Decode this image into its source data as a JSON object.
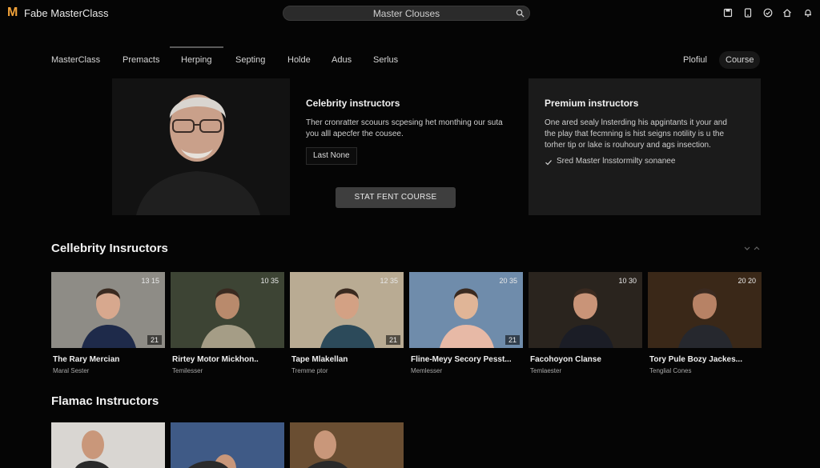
{
  "app": {
    "brand": "Fabe MasterClass"
  },
  "search": {
    "text": "Master Clouses"
  },
  "nav": {
    "items": [
      "MasterClass",
      "Premacts",
      "Herping",
      "Septing",
      "Holde",
      "Adus",
      "Serlus"
    ],
    "right": [
      "Plofiul",
      "Course"
    ]
  },
  "hero": {
    "center": {
      "title": "Celebrity instructors",
      "text1": "Ther cronratter scouurs scpesing het monthing our suta",
      "text2": "you alll apecfer the cousee.",
      "last_label": "Last None",
      "start_label": "STAT FENT COURSE"
    },
    "right": {
      "title": "Premium instructors",
      "text1": "One ared sealy lnsterding his apgintants it your and",
      "text2": "the play that fecmning is hist seigns notility is u the",
      "text3": "torher tip or lake is rouhoury and ags insection.",
      "check_text": "Sred Master lnsstormilty sonanee"
    }
  },
  "sections": {
    "celebrity_title": "Cellebrity Insructors",
    "flamac_title": "Flamac Instructors"
  },
  "cards": [
    {
      "name": "The Rary Mercian",
      "sub": "Maral Sester",
      "duration": "13 15",
      "num": "21",
      "bg": "#8e8c86"
    },
    {
      "name": "Rirtey Motor Mickhon..",
      "sub": "Temilesser",
      "duration": "10 35",
      "num": "",
      "bg": "#3d4434"
    },
    {
      "name": "Tape Mlakellan",
      "sub": "Tremme ptor",
      "duration": "12 35",
      "num": "21",
      "bg": "#b9ab93"
    },
    {
      "name": "Fline-Meyy Secory Pesst...",
      "sub": "Memlesser",
      "duration": "20 35",
      "num": "21",
      "bg": "#6f8cab"
    },
    {
      "name": "Facohoyon Clanse",
      "sub": "Temlaester",
      "duration": "10 30",
      "num": "",
      "bg": "#2a241e"
    },
    {
      "name": "Tory Pule Bozy Jackes...",
      "sub": "Tenglial Cones",
      "duration": "20 20",
      "num": "",
      "bg": "#3a2818"
    }
  ],
  "cards2": [
    {
      "bg": "#d9d6d2"
    },
    {
      "bg": "#3f5a86"
    },
    {
      "bg": "#6a4e32"
    }
  ],
  "colors": {
    "accent": "#f2a33a",
    "bg": "#050505",
    "panel": "#1b1b1b"
  }
}
